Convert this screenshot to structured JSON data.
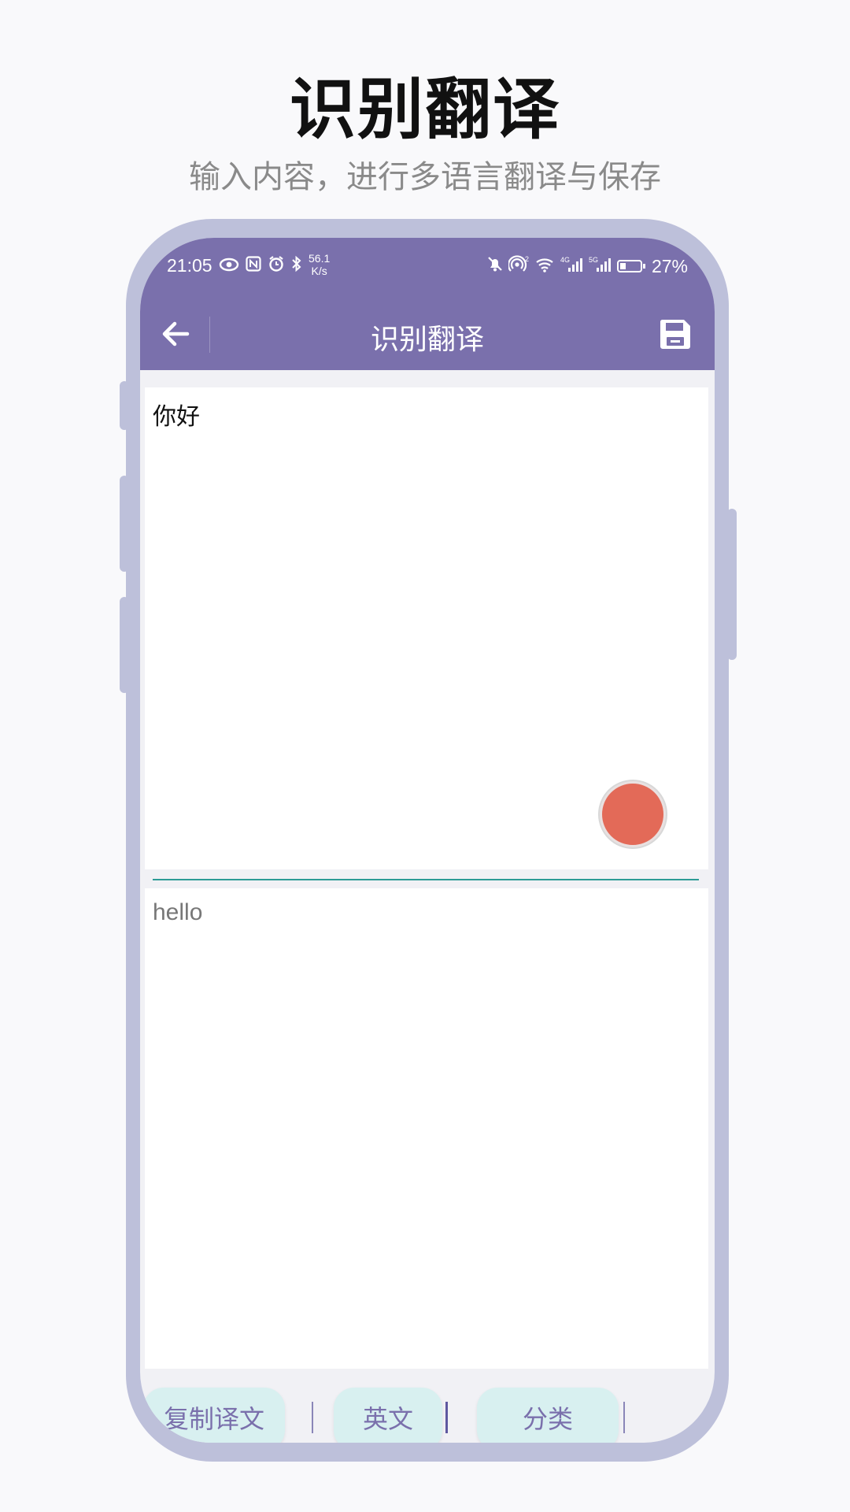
{
  "promo": {
    "title": "识别翻译",
    "subtitle": "输入内容，进行多语言翻译与保存"
  },
  "status_bar": {
    "time": "21:05",
    "speed_value": "56.1",
    "speed_unit": "K/s",
    "battery": "27%",
    "icons_left": [
      "eye-icon",
      "nfc-icon",
      "alarm-icon",
      "bluetooth-icon"
    ],
    "icons_right": [
      "mute-icon",
      "hotspot-icon",
      "wifi-icon",
      "signal-4g-icon",
      "signal-5g-icon",
      "battery-icon"
    ]
  },
  "toolbar": {
    "title": "识别翻译"
  },
  "input": {
    "text": "你好"
  },
  "output": {
    "text": "hello"
  },
  "bottom_bar": {
    "copy_label": "复制译文",
    "language_label": "英文",
    "category_label": "分类"
  },
  "colors": {
    "header": "#7a70ac",
    "phone_frame": "#bdc0da",
    "record_button": "#e36a58",
    "divider": "#2d9b96",
    "bottom_button": "#d8f0f0"
  }
}
